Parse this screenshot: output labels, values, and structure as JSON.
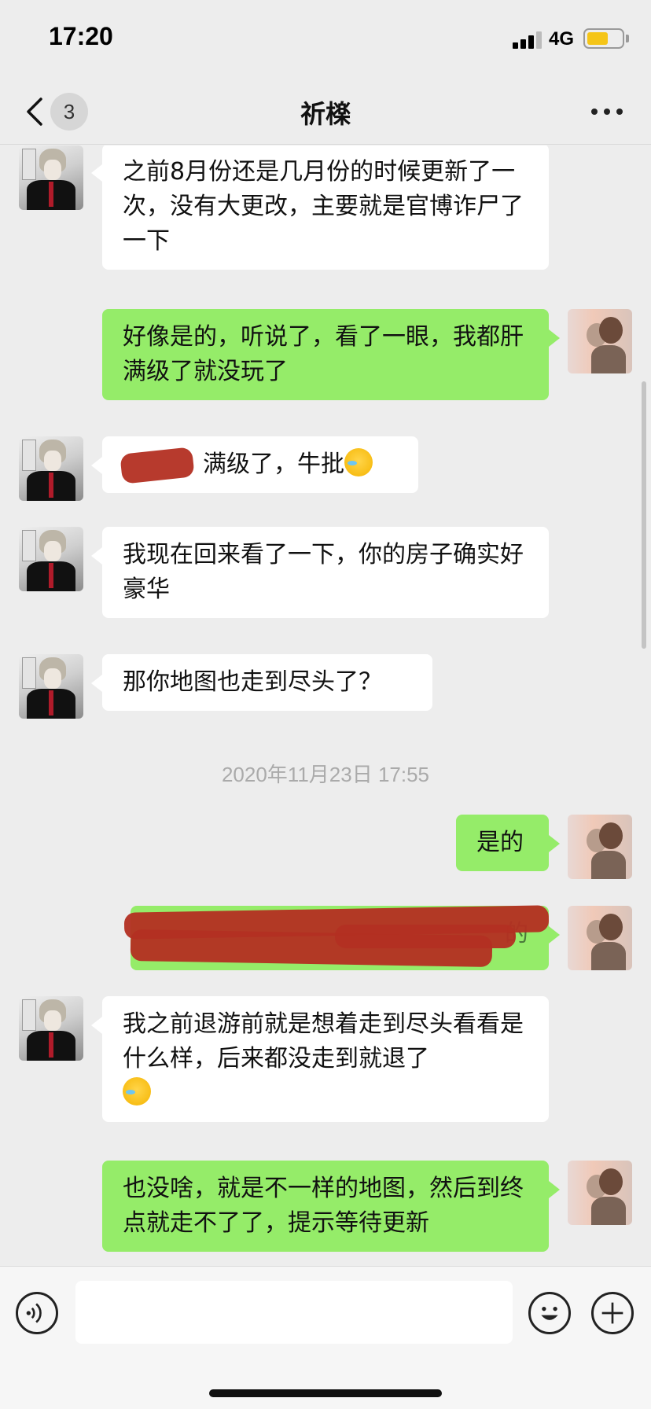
{
  "status_bar": {
    "time": "17:20",
    "network": "4G",
    "battery_level": 0.55,
    "battery_color": "#f5c518"
  },
  "nav": {
    "back_icon": "chevron-left-icon",
    "unread_count": "3",
    "title": "祈檪",
    "more_icon": "more-horizontal-icon"
  },
  "messages": [
    {
      "sender": "other",
      "text": "之前8月份还是几月份的时候更新了一次，没有大更改，主要就是官博诈尸了一下"
    },
    {
      "sender": "me",
      "text": "好像是的，听说了，看了一眼，我都肝满级了就没玩了"
    },
    {
      "sender": "other",
      "text": "满级了，牛批",
      "redacted": true,
      "emoji": "cry-laugh-emoji"
    },
    {
      "sender": "other",
      "text": "我现在回来看了一下，你的房子确实好豪华"
    },
    {
      "sender": "other",
      "text": "那你地图也走到尽头了？"
    },
    {
      "sender": "me",
      "text": "是的"
    },
    {
      "sender": "me",
      "text": "的",
      "redacted": true
    },
    {
      "sender": "other",
      "text": "我之前退游前就是想着走到尽头看看是什么样，后来都没走到就退了",
      "emoji": "cry-laugh-emoji"
    },
    {
      "sender": "me",
      "text": "也没啥，就是不一样的地图，然后到终点就走不了了，提示等待更新"
    }
  ],
  "timestamp": "2020年11月23日 17:55",
  "colors": {
    "background": "#ededed",
    "bubble_out": "#95ec69",
    "bubble_in": "#ffffff",
    "redaction": "#b32f22"
  },
  "input_bar": {
    "voice_icon": "voice-icon",
    "emoji_icon": "smiley-icon",
    "plus_icon": "plus-icon",
    "value": ""
  }
}
